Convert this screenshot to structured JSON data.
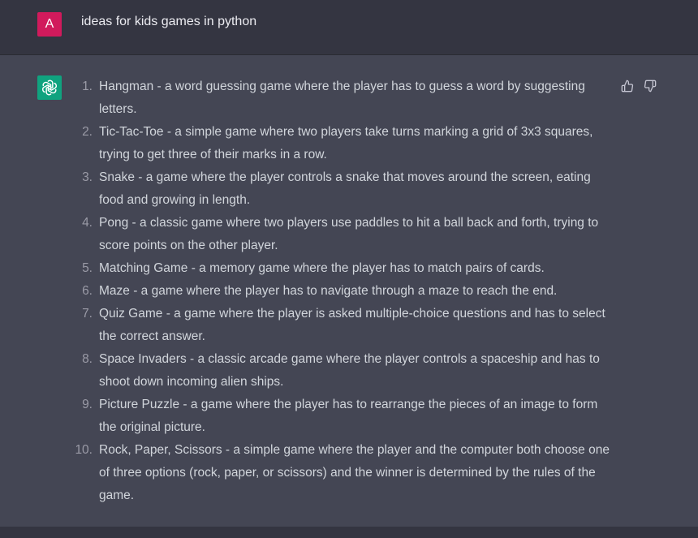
{
  "user_message": {
    "avatar_letter": "A",
    "text": "ideas for kids games in python"
  },
  "assistant_message": {
    "avatar_icon": "openai-logo-icon",
    "items": [
      {
        "number": "1.",
        "text": "Hangman - a word guessing game where the player has to guess a word by suggesting letters."
      },
      {
        "number": "2.",
        "text": "Tic-Tac-Toe - a simple game where two players take turns marking a grid of 3x3 squares, trying to get three of their marks in a row."
      },
      {
        "number": "3.",
        "text": "Snake - a game where the player controls a snake that moves around the screen, eating food and growing in length."
      },
      {
        "number": "4.",
        "text": "Pong - a classic game where two players use paddles to hit a ball back and forth, trying to score points on the other player."
      },
      {
        "number": "5.",
        "text": "Matching Game - a memory game where the player has to match pairs of cards."
      },
      {
        "number": "6.",
        "text": "Maze - a game where the player has to navigate through a maze to reach the end."
      },
      {
        "number": "7.",
        "text": "Quiz Game - a game where the player is asked multiple-choice questions and has to select the correct answer."
      },
      {
        "number": "8.",
        "text": "Space Invaders - a classic arcade game where the player controls a spaceship and has to shoot down incoming alien ships."
      },
      {
        "number": "9.",
        "text": "Picture Puzzle - a game where the player has to rearrange the pieces of an image to form the original picture."
      },
      {
        "number": "10.",
        "text": "Rock, Paper, Scissors - a simple game where the player and the computer both choose one of three options (rock, paper, or scissors) and the winner is determined by the rules of the game."
      }
    ],
    "feedback_icons": [
      "thumbs-up-icon",
      "thumbs-down-icon"
    ]
  },
  "colors": {
    "user_avatar_bg": "#d11a5c",
    "assistant_avatar_bg": "#10a37f",
    "user_row_bg": "#343541",
    "assistant_row_bg": "#444654",
    "text": "#d1d5db"
  }
}
